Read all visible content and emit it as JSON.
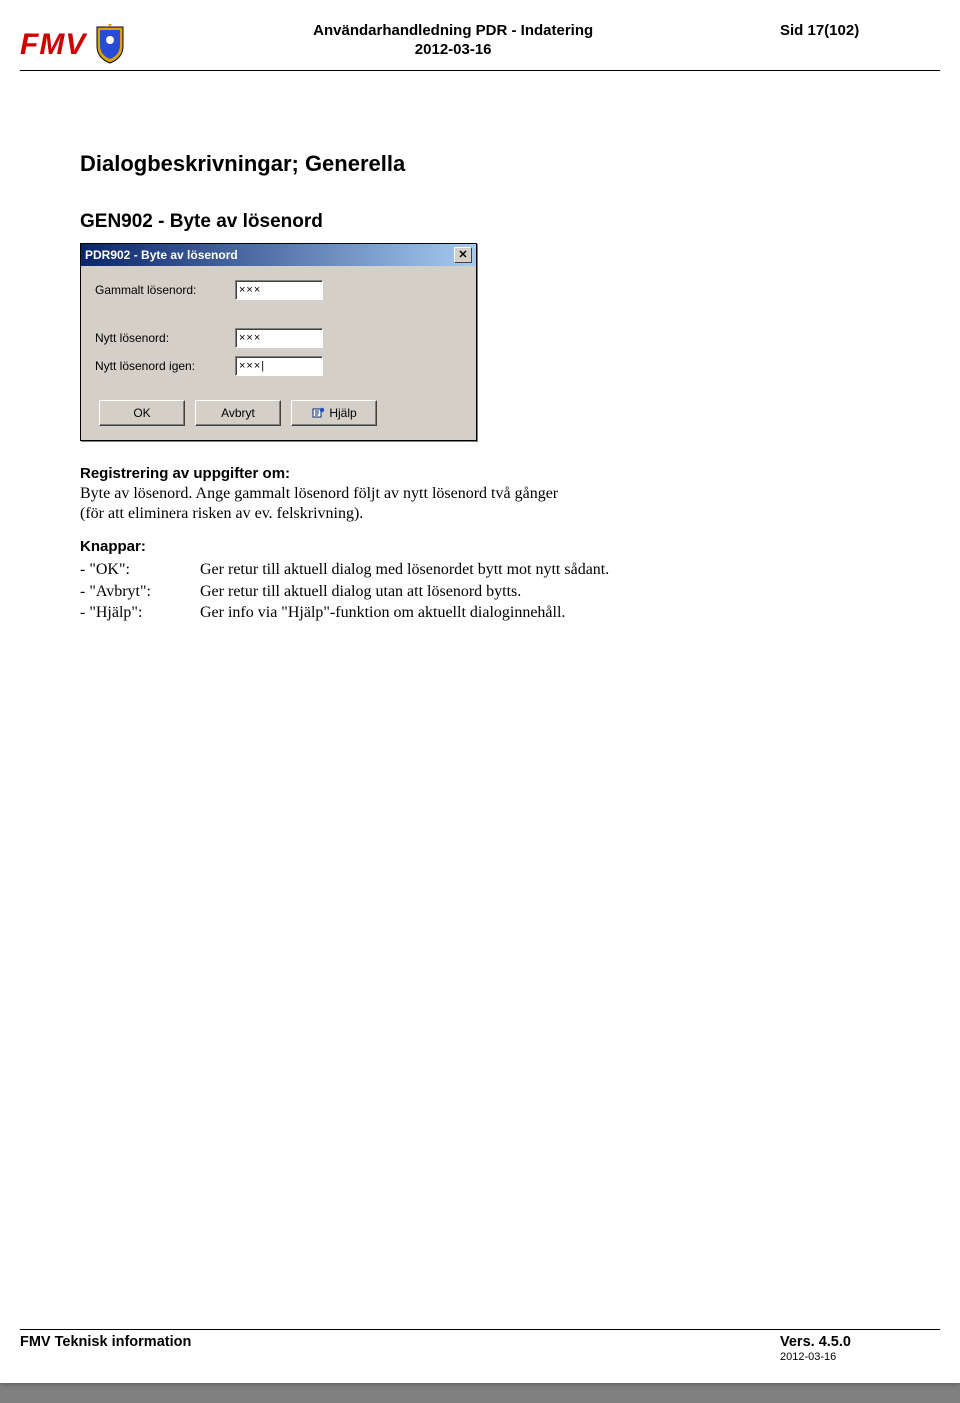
{
  "header": {
    "logo_text": "FMV",
    "title": "Användarhandledning PDR - Indatering",
    "date": "2012-03-16",
    "page": "Sid 17(102)"
  },
  "section_title": "Dialogbeskrivningar; Generella",
  "subsection_title": "GEN902 - Byte av lösenord",
  "dialog": {
    "title": "PDR902 - Byte av lösenord",
    "close_glyph": "✕",
    "fields": {
      "old_label": "Gammalt lösenord:",
      "old_value": "×××",
      "new_label": "Nytt lösenord:",
      "new_value": "×××",
      "again_label": "Nytt lösenord igen:",
      "again_value": "×××|"
    },
    "buttons": {
      "ok": "OK",
      "cancel": "Avbryt",
      "help": "Hjälp"
    }
  },
  "reg": {
    "heading": "Registrering av uppgifter om:",
    "line1": "Byte av lösenord. Ange gammalt lösenord följt av nytt lösenord två gånger",
    "line2": "(för att eliminera risken av ev. felskrivning)."
  },
  "knappar": {
    "heading": "Knappar:",
    "rows": [
      {
        "key": "- \"OK\":",
        "val": "Ger retur till aktuell dialog med lösenordet bytt mot nytt sådant."
      },
      {
        "key": "- \"Avbryt\":",
        "val": "Ger retur till aktuell dialog utan att lösenord bytts."
      },
      {
        "key": "- \"Hjälp\":",
        "val": "Ger info via \"Hjälp\"-funktion om aktuellt dialoginnehåll."
      }
    ]
  },
  "footer": {
    "left": "FMV Teknisk information",
    "version": "Vers. 4.5.0",
    "date": "2012-03-16"
  }
}
